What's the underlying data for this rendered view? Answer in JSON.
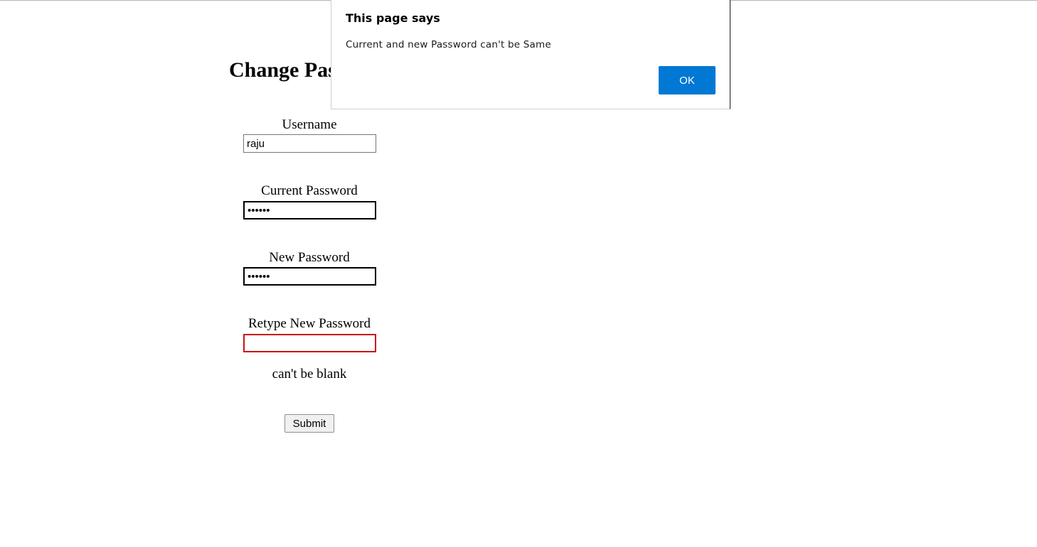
{
  "page": {
    "title": "Change Password"
  },
  "form": {
    "username": {
      "label": "Username",
      "value": "raju"
    },
    "current_password": {
      "label": "Current Password",
      "value": "••••••"
    },
    "new_password": {
      "label": "New Password",
      "value": "••••••"
    },
    "retype_new_password": {
      "label": "Retype New Password",
      "value": ""
    },
    "error_message": "can't be blank",
    "submit_label": "Submit"
  },
  "dialog": {
    "title": "This page says",
    "message": "Current and new Password can't be Same",
    "ok_label": "OK",
    "ok_color": "#0078d4"
  },
  "colors": {
    "error_border": "#cc1010"
  }
}
